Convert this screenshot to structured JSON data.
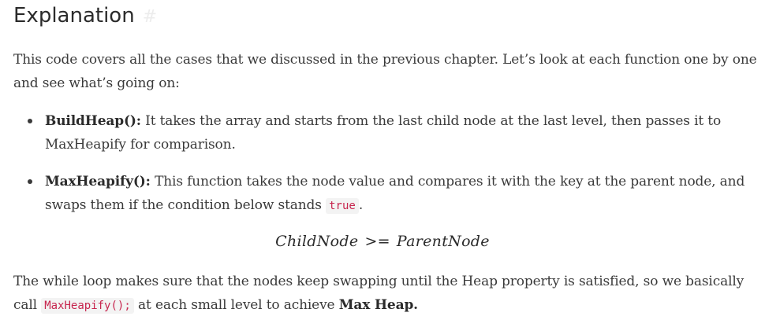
{
  "heading": {
    "title": "Explanation",
    "anchor": "#"
  },
  "intro": {
    "text": "This code covers all the cases that we discussed in the previous chapter. Let’s look at each function one by one and see what’s going on:"
  },
  "bullets": [
    {
      "term": "BuildHeap():",
      "text": " It takes the array and starts from the last child node at the last level, then passes it to MaxHeapify for comparison."
    },
    {
      "term": "MaxHeapify():",
      "text": " This function takes the node value and compares it with the key at the parent node, and swaps them if the condition below stands ",
      "code": "true",
      "after": "."
    }
  ],
  "formula": {
    "left": "ChildNode",
    "operator": ">=",
    "right": "ParentNode"
  },
  "closing": {
    "text_before": "The while loop makes sure that the nodes keep swapping until the Heap property is satisfied, so we basically call ",
    "code": "MaxHeapify();",
    "text_middle": " at each small level to achieve ",
    "bold": "Max Heap.",
    "text_after": ""
  }
}
